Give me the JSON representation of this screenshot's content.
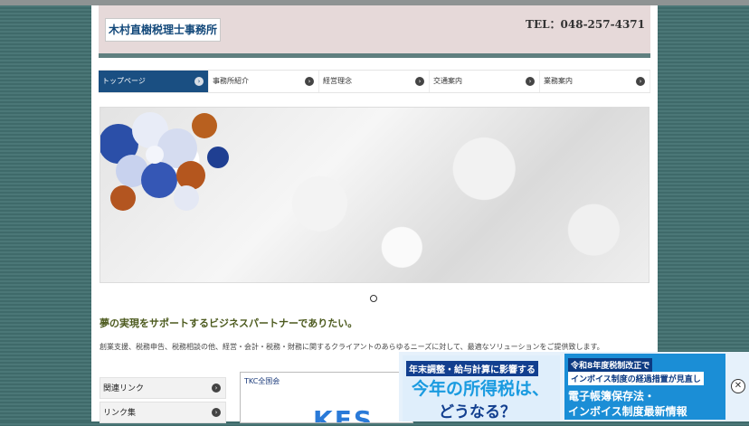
{
  "header": {
    "logo_text": "木村直樹税理士事務所",
    "tel": "TEL：048-257-4371"
  },
  "nav": {
    "items": [
      {
        "label": "トップページ"
      },
      {
        "label": "事務所紹介"
      },
      {
        "label": "経営理念"
      },
      {
        "label": "交通案内"
      },
      {
        "label": "業務案内"
      }
    ],
    "chevron": "›"
  },
  "hero": {
    "slides_total": 1
  },
  "main": {
    "headline": "夢の実現をサポートするビジネスパートナーでありたい。",
    "description": "創業支援、税務申告、税務相談の他、経営・会計・税務・財務に関するクライアントのあらゆるニーズに対して、最適なソリューションをご提供致します。"
  },
  "sidebar": {
    "items": [
      {
        "label": "関連リンク"
      },
      {
        "label": "リンク集"
      }
    ]
  },
  "tkc_banner": {
    "label": "TKC全国会",
    "big_text": "KFS"
  },
  "ad": {
    "left_line1": "年末調整・給与計算に影響する",
    "left_line2": "今年の所得税は、",
    "left_line3": "どうなる？",
    "right_line1": "令和8年度税制改正で",
    "right_line2": "インボイス制度の経過措置が見直し",
    "right_line3": "電子帳簿保存法・",
    "right_line4": "インボイス制度最新情報",
    "close": "✕"
  },
  "colors": {
    "nav_active": "#1a4f82",
    "header_bg": "#e6d9d9",
    "headline": "#4d5b1f",
    "background": "#3f6a6a"
  }
}
